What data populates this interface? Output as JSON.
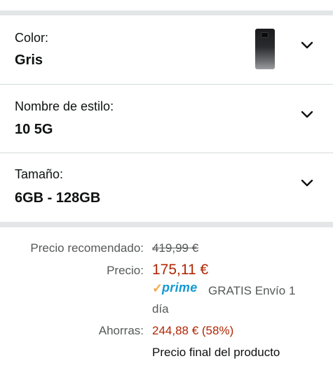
{
  "options": [
    {
      "label": "Color:",
      "value": "Gris",
      "has_thumbnail": true,
      "icon": "chevron-down-icon"
    },
    {
      "label": "Nombre de estilo:",
      "value": "10 5G",
      "has_thumbnail": false,
      "icon": "chevron-down-icon"
    },
    {
      "label": "Tamaño:",
      "value": "6GB - 128GB",
      "has_thumbnail": false,
      "icon": "chevron-down-icon"
    }
  ],
  "pricing": {
    "list_price_label": "Precio recomendado:",
    "list_price": "419,99 €",
    "price_label": "Precio:",
    "price": "175,11 €",
    "prime_check": "✓",
    "prime_word": "prime",
    "shipping": "GRATIS Envío 1 día",
    "savings_label": "Ahorras:",
    "savings": "244,88 € (58%)",
    "final_note": "Precio final del producto"
  },
  "colors": {
    "price_red": "#b12704",
    "prime_blue": "#1399d4",
    "prime_orange": "#f3a847",
    "muted_text": "#565959",
    "divider": "#e3e6e6"
  }
}
